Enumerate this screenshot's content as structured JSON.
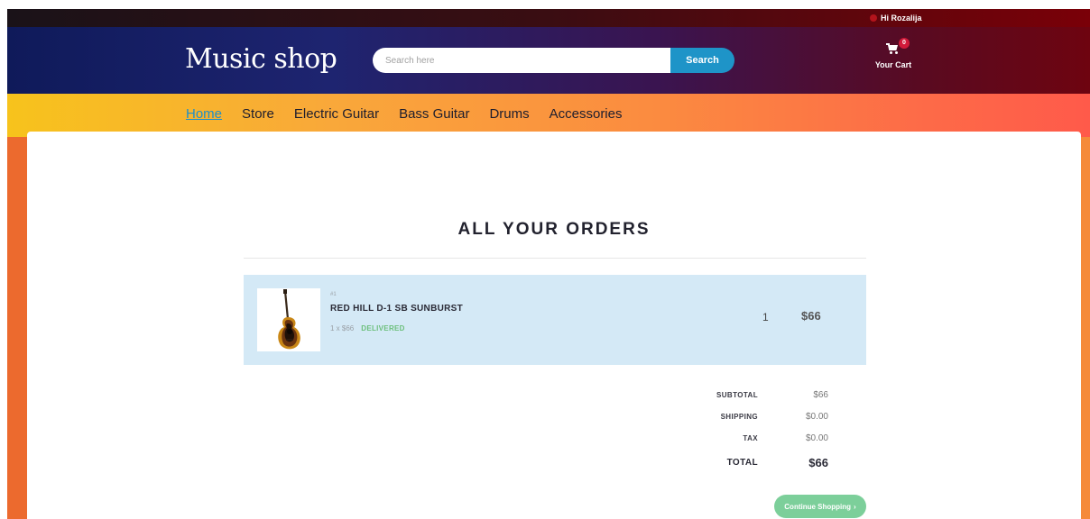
{
  "topbar": {
    "greeting": "Hi Rozalija"
  },
  "header": {
    "logo": "Music shop",
    "search": {
      "placeholder": "Search here",
      "button": "Search"
    },
    "cart": {
      "count": "0",
      "label": "Your Cart"
    }
  },
  "nav": {
    "items": [
      "Home",
      "Store",
      "Electric Guitar",
      "Bass Guitar",
      "Drums",
      "Accessories"
    ],
    "active": "Home"
  },
  "orders": {
    "title": "ALL YOUR ORDERS",
    "items": [
      {
        "number": "#1",
        "name": "RED HILL D-1 SB SUNBURST",
        "unit_price": "1 x $66",
        "status": "DELIVERED",
        "quantity": "1",
        "total": "$66"
      }
    ],
    "summary": {
      "subtotal_label": "SUBTOTAL",
      "subtotal": "$66",
      "shipping_label": "SHIPPING",
      "shipping": "$0.00",
      "tax_label": "TAX",
      "tax": "$0.00",
      "total_label": "TOTAL",
      "total": "$66"
    },
    "continue_label": "Continue Shopping",
    "continue_arrow": "›"
  },
  "colors": {
    "accent": "#1e94c8",
    "delivered": "#6cbf7c",
    "cart_badge": "#d11a3a",
    "order_row_bg": "#d4e9f6"
  }
}
